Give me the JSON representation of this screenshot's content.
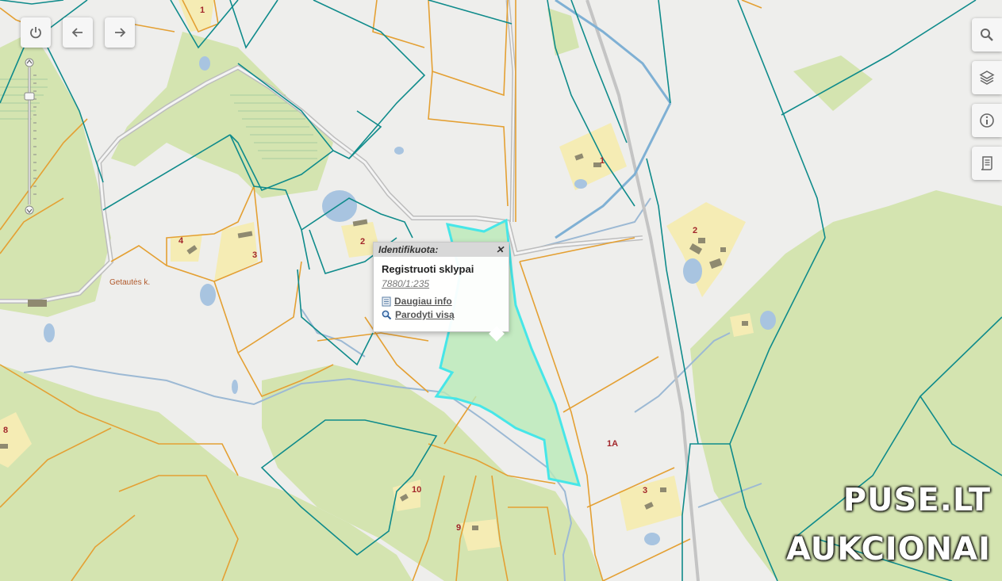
{
  "toolbar": {
    "left": [
      {
        "icon": "power-icon"
      },
      {
        "icon": "back-arrow-icon"
      },
      {
        "icon": "forward-arrow-icon"
      }
    ],
    "right": [
      {
        "icon": "search-icon"
      },
      {
        "icon": "layers-icon"
      },
      {
        "icon": "info-icon"
      },
      {
        "icon": "legend-icon"
      }
    ]
  },
  "popup": {
    "header": "Identifikuota:",
    "layer_name": "Registruoti sklypai",
    "plot_id": "7880/1:235",
    "more_info": "Daugiau info",
    "show_all": "Parodyti visą"
  },
  "map_labels": {
    "village": "Getautės k.",
    "numbers": [
      "1",
      "1",
      "2",
      "2",
      "3",
      "3",
      "4",
      "8",
      "9",
      "10",
      "1A"
    ]
  },
  "watermark": {
    "line1": "PUSE.LT",
    "line2": "AUKCIONAI"
  },
  "colors": {
    "background": "#eeeeec",
    "forest": "#d4e4b0",
    "building_area": "#f5ecb4",
    "water": "#a8c4e0",
    "parcel_line": "#e4a033",
    "forest_boundary": "#0f8b8b",
    "selected_fill": "#b9eab8",
    "selected_stroke": "#46e6e8",
    "label": "#a2262b"
  }
}
